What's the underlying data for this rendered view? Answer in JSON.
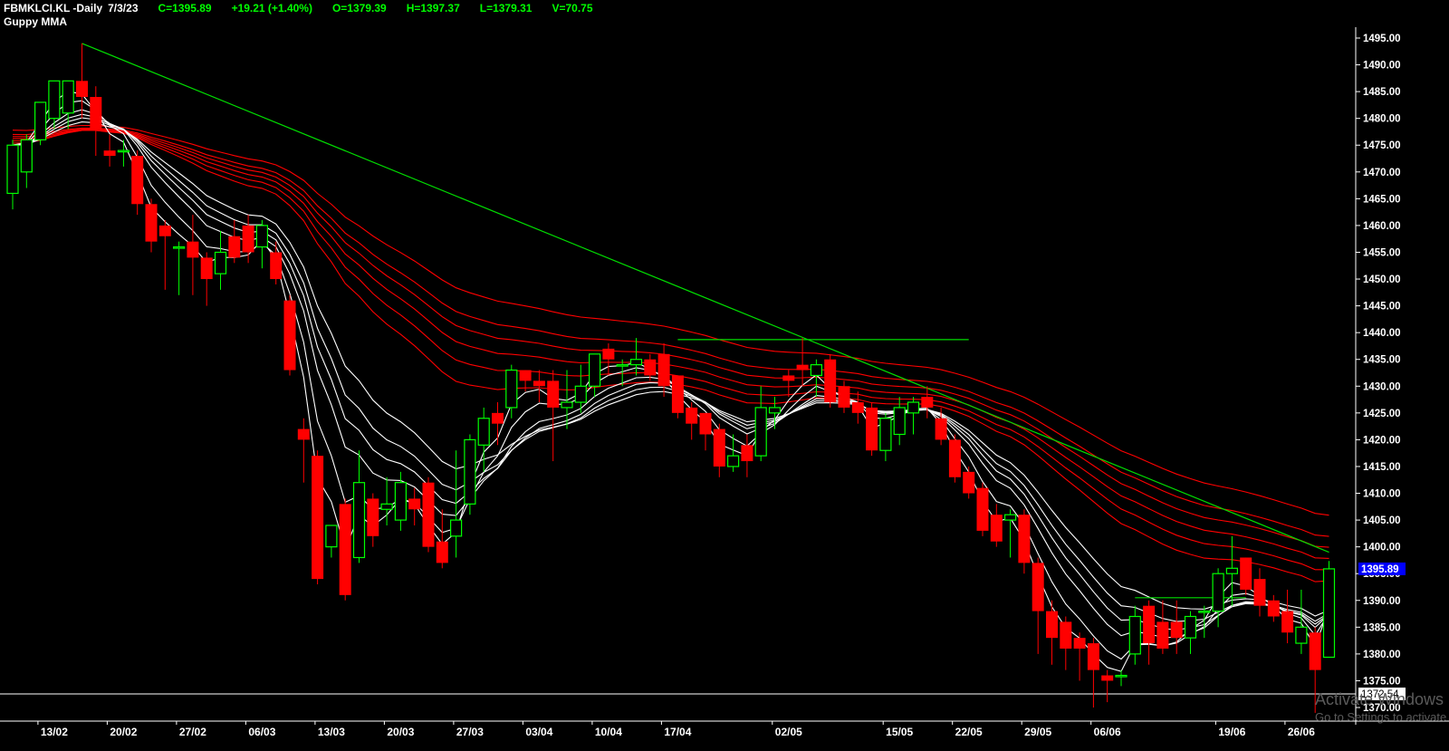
{
  "header": {
    "symbol": "FBMKLCI.KL -Daily",
    "date": "7/3/23",
    "close": "C=1395.89",
    "change": "+19.21 (+1.40%)",
    "open": "O=1379.39",
    "high": "H=1397.37",
    "low": "L=1379.31",
    "volume": "V=70.75",
    "indicator": "Guppy MMA"
  },
  "watermark": {
    "line1": "Activate Windows",
    "line2": "Go to Settings to activate"
  },
  "colors": {
    "background": "#000000",
    "bull": "#00ff00",
    "bear": "#ff0000",
    "short_mma": "#ffffff",
    "long_mma": "#ff0000",
    "trendline": "#00dd00",
    "last_price_box": "#0000ff"
  },
  "chart_data": {
    "type": "candlestick",
    "y_axis": {
      "min": 1370,
      "max": 1495,
      "ticks": [
        "1495.00",
        "1490.00",
        "1485.00",
        "1480.00",
        "1475.00",
        "1470.00",
        "1465.00",
        "1460.00",
        "1455.00",
        "1450.00",
        "1445.00",
        "1440.00",
        "1435.00",
        "1430.00",
        "1425.00",
        "1420.00",
        "1415.00",
        "1410.00",
        "1405.00",
        "1400.00",
        "1395.00",
        "1390.00",
        "1385.00",
        "1380.00",
        "1375.00",
        "1370.00"
      ],
      "position": "right"
    },
    "x_axis": {
      "ticks": [
        {
          "label": "13/02",
          "index": 3
        },
        {
          "label": "20/02",
          "index": 8
        },
        {
          "label": "27/02",
          "index": 13
        },
        {
          "label": "06/03",
          "index": 18
        },
        {
          "label": "13/03",
          "index": 23
        },
        {
          "label": "20/03",
          "index": 28
        },
        {
          "label": "27/03",
          "index": 33
        },
        {
          "label": "03/04",
          "index": 38
        },
        {
          "label": "10/04",
          "index": 43
        },
        {
          "label": "17/04",
          "index": 48
        },
        {
          "label": "02/05",
          "index": 56
        },
        {
          "label": "15/05",
          "index": 64
        },
        {
          "label": "22/05",
          "index": 69
        },
        {
          "label": "29/05",
          "index": 74
        },
        {
          "label": "06/06",
          "index": 79
        },
        {
          "label": "19/06",
          "index": 88
        },
        {
          "label": "26/06",
          "index": 93
        }
      ]
    },
    "last_price_label": "1395.89",
    "hline_label": "1372.54",
    "hline_value": 1372.54,
    "ohlc": [
      [
        1466,
        1476,
        1463,
        1475
      ],
      [
        1470,
        1477,
        1467,
        1476
      ],
      [
        1476,
        1483,
        1475,
        1483
      ],
      [
        1480,
        1486,
        1478,
        1487
      ],
      [
        1481,
        1486,
        1478,
        1487
      ],
      [
        1487,
        1494,
        1480,
        1484
      ],
      [
        1484,
        1486,
        1473,
        1478
      ],
      [
        1474,
        1477,
        1471,
        1473
      ],
      [
        1474,
        1476,
        1471,
        1474
      ],
      [
        1473,
        1474,
        1462,
        1464
      ],
      [
        1464,
        1465,
        1455,
        1457
      ],
      [
        1460,
        1461,
        1448,
        1458
      ],
      [
        1456,
        1457,
        1447,
        1456
      ],
      [
        1457,
        1462,
        1447,
        1454
      ],
      [
        1454,
        1455,
        1445,
        1450
      ],
      [
        1451,
        1459,
        1448,
        1455
      ],
      [
        1458,
        1461,
        1453,
        1454
      ],
      [
        1460,
        1462,
        1453,
        1455
      ],
      [
        1456,
        1461,
        1452,
        1460
      ],
      [
        1455,
        1457,
        1449,
        1450
      ],
      [
        1446,
        1447,
        1432,
        1433
      ],
      [
        1422,
        1424,
        1412,
        1420
      ],
      [
        1417,
        1418,
        1393,
        1394
      ],
      [
        1400,
        1404,
        1398,
        1404
      ],
      [
        1408,
        1409,
        1390,
        1391
      ],
      [
        1398,
        1418,
        1397,
        1412
      ],
      [
        1409,
        1410,
        1400,
        1402
      ],
      [
        1407,
        1413,
        1404,
        1408
      ],
      [
        1405,
        1414,
        1403,
        1412
      ],
      [
        1409,
        1411,
        1404,
        1407
      ],
      [
        1412,
        1413,
        1399,
        1400
      ],
      [
        1401,
        1407,
        1396,
        1397
      ],
      [
        1402,
        1418,
        1398,
        1405
      ],
      [
        1408,
        1421,
        1406,
        1420
      ],
      [
        1419,
        1426,
        1414,
        1424
      ],
      [
        1425,
        1427,
        1419,
        1423
      ],
      [
        1426,
        1434,
        1424,
        1433
      ],
      [
        1433,
        1433,
        1429,
        1431
      ],
      [
        1431,
        1433,
        1427,
        1430
      ],
      [
        1431,
        1433,
        1416,
        1426
      ],
      [
        1426,
        1433,
        1422,
        1427
      ],
      [
        1427,
        1434,
        1425,
        1430
      ],
      [
        1430,
        1436,
        1428,
        1436
      ],
      [
        1437,
        1438,
        1432,
        1435
      ],
      [
        1434,
        1435,
        1430,
        1434
      ],
      [
        1434,
        1439,
        1432,
        1435
      ],
      [
        1435,
        1436,
        1431,
        1432
      ],
      [
        1436,
        1438,
        1428,
        1430
      ],
      [
        1432,
        1432,
        1424,
        1425
      ],
      [
        1426,
        1427,
        1420,
        1423
      ],
      [
        1425,
        1425,
        1418,
        1421
      ],
      [
        1422,
        1423,
        1413,
        1415
      ],
      [
        1415,
        1421,
        1414,
        1417
      ],
      [
        1419,
        1421,
        1413,
        1416
      ],
      [
        1417,
        1430,
        1416,
        1426
      ],
      [
        1425,
        1428,
        1422,
        1426
      ],
      [
        1432,
        1433,
        1428,
        1431
      ],
      [
        1434,
        1439,
        1430,
        1433
      ],
      [
        1432,
        1435,
        1428,
        1434
      ],
      [
        1435,
        1436,
        1426,
        1427
      ],
      [
        1430,
        1431,
        1425,
        1426
      ],
      [
        1427,
        1429,
        1423,
        1425
      ],
      [
        1426,
        1427,
        1417,
        1418
      ],
      [
        1418,
        1425,
        1416,
        1424
      ],
      [
        1421,
        1428,
        1419,
        1426
      ],
      [
        1425,
        1428,
        1421,
        1427
      ],
      [
        1428,
        1430,
        1424,
        1426
      ],
      [
        1424,
        1426,
        1419,
        1420
      ],
      [
        1420,
        1421,
        1412,
        1413
      ],
      [
        1414,
        1415,
        1409,
        1410
      ],
      [
        1411,
        1412,
        1402,
        1403
      ],
      [
        1406,
        1408,
        1400,
        1401
      ],
      [
        1405,
        1407,
        1398,
        1406
      ],
      [
        1406,
        1407,
        1395,
        1397
      ],
      [
        1397,
        1398,
        1380,
        1388
      ],
      [
        1388,
        1390,
        1378,
        1383
      ],
      [
        1386,
        1387,
        1377,
        1381
      ],
      [
        1383,
        1384,
        1375,
        1381
      ],
      [
        1382,
        1383,
        1370,
        1377
      ],
      [
        1376,
        1377,
        1371,
        1375
      ],
      [
        1376,
        1377,
        1374,
        1376
      ],
      [
        1380,
        1389,
        1378,
        1387
      ],
      [
        1389,
        1390,
        1378,
        1382
      ],
      [
        1386,
        1390,
        1380,
        1381
      ],
      [
        1386,
        1390,
        1380,
        1383
      ],
      [
        1383,
        1388,
        1380,
        1387
      ],
      [
        1388,
        1389,
        1383,
        1388
      ],
      [
        1388,
        1396,
        1385,
        1395
      ],
      [
        1395,
        1402,
        1389,
        1396
      ],
      [
        1398,
        1398,
        1391,
        1392
      ],
      [
        1394,
        1396,
        1387,
        1389
      ],
      [
        1390,
        1391,
        1386,
        1387
      ],
      [
        1388,
        1392,
        1382,
        1384
      ],
      [
        1382,
        1392,
        1380,
        1385
      ],
      [
        1384,
        1385,
        1369,
        1377
      ],
      [
        1379.39,
        1397.37,
        1379.31,
        1395.89
      ]
    ],
    "trendlines": [
      {
        "from": [
          5,
          1494
        ],
        "to": [
          95,
          1399
        ]
      },
      {
        "from": [
          48,
          1438.7
        ],
        "to": [
          69,
          1438.7
        ]
      },
      {
        "from": [
          81,
          1390.5
        ],
        "to": [
          89,
          1390.5
        ]
      }
    ],
    "mma_short_periods": [
      3,
      5,
      8,
      10,
      12,
      15
    ],
    "mma_long_periods": [
      30,
      35,
      40,
      45,
      50,
      60
    ]
  }
}
